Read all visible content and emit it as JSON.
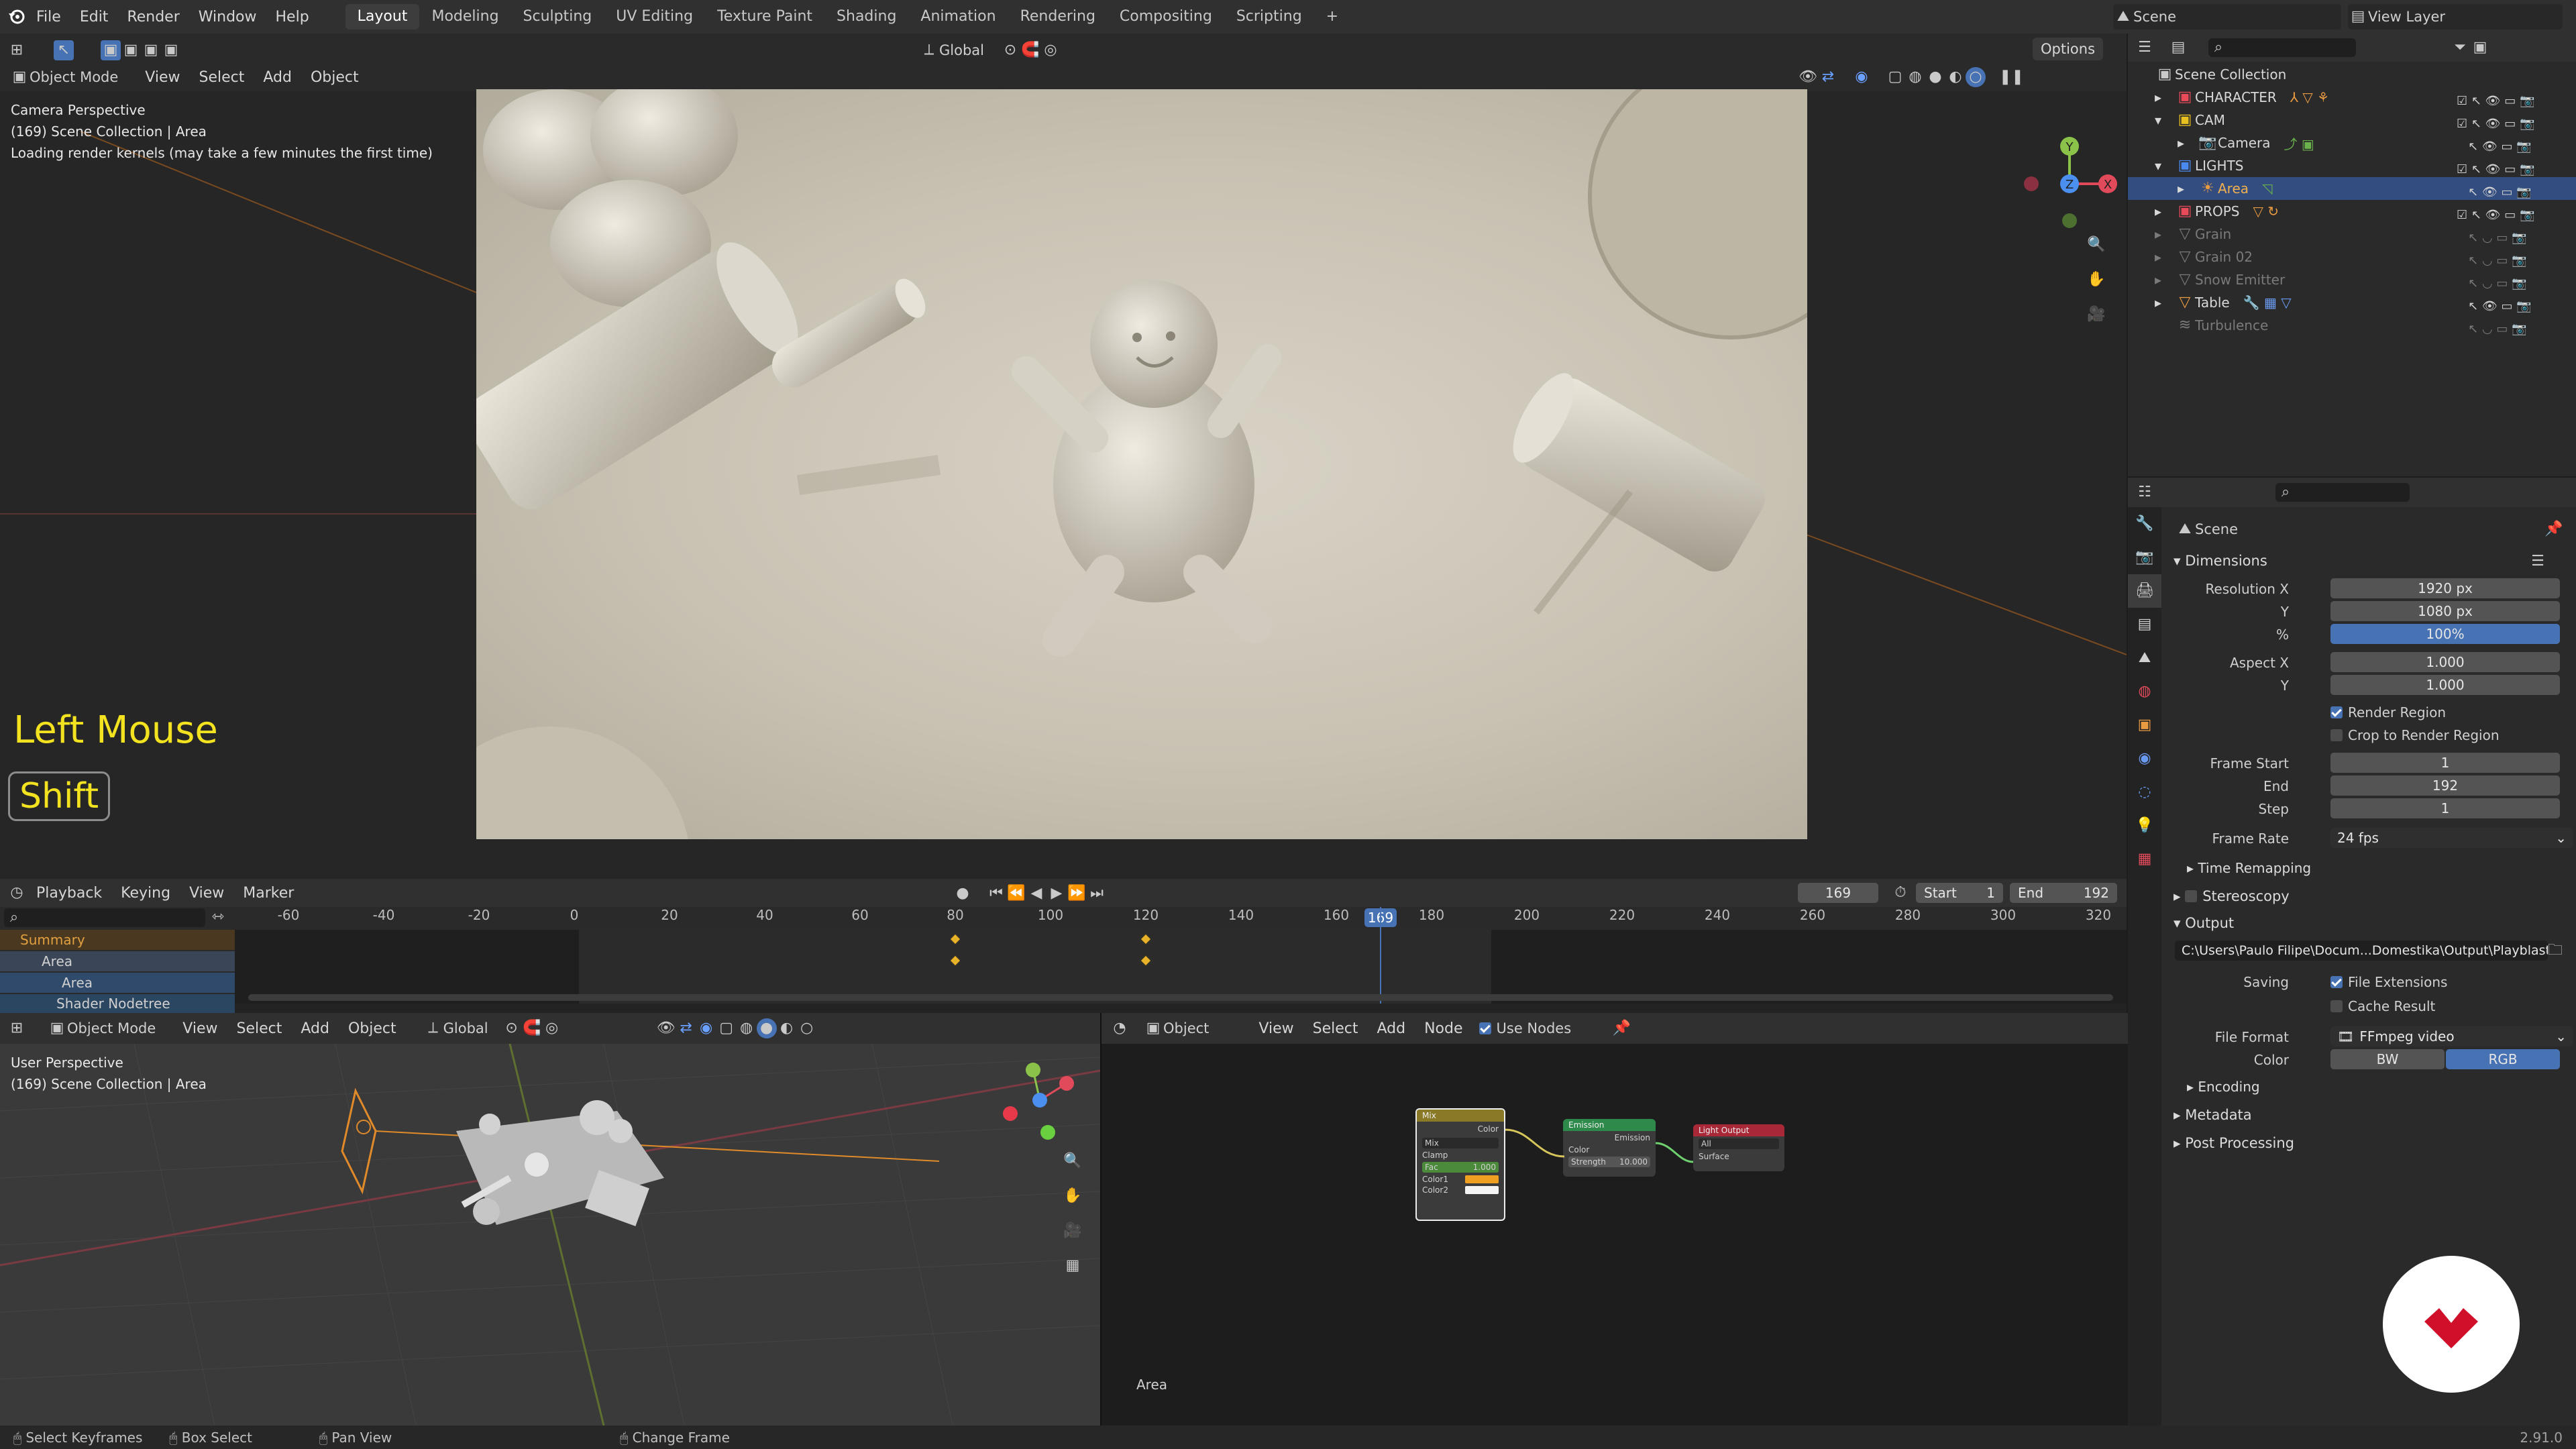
{
  "topbar": {
    "menus": [
      "File",
      "Edit",
      "Render",
      "Window",
      "Help"
    ],
    "workspaces": [
      "Layout",
      "Modeling",
      "Sculpting",
      "UV Editing",
      "Texture Paint",
      "Shading",
      "Animation",
      "Rendering",
      "Compositing",
      "Scripting"
    ],
    "add_tab": "+",
    "scene_name": "Scene",
    "view_layer": "View Layer"
  },
  "viewport": {
    "mode": "Object Mode",
    "menus": [
      "View",
      "Select",
      "Add",
      "Object"
    ],
    "transform_orientation": "Global",
    "options": "Options",
    "info_line1": "Camera Perspective",
    "info_line2": "(169) Scene Collection | Area",
    "info_line3": "Loading render kernels (may take a few minutes the first time)",
    "key_mouse": "Left Mouse",
    "key_modifier": "Shift",
    "gizmo": {
      "x": "X",
      "y": "Y",
      "z": "Z"
    }
  },
  "timeline": {
    "menus": [
      "Playback",
      "Keying",
      "View",
      "Marker"
    ],
    "current_frame": "169",
    "start_label": "Start",
    "start": "1",
    "end_label": "End",
    "end": "192",
    "ticks": [
      "-60",
      "-40",
      "-20",
      "0",
      "20",
      "40",
      "60",
      "80",
      "100",
      "120",
      "140",
      "160",
      "180",
      "200",
      "220",
      "240",
      "260",
      "280",
      "300",
      "320"
    ],
    "playhead": "169",
    "channels": [
      "Summary",
      "Area",
      "Area",
      "Shader Nodetree"
    ]
  },
  "viewport2": {
    "mode": "Object Mode",
    "menus": [
      "View",
      "Select",
      "Add",
      "Object"
    ],
    "transform_orientation": "Global",
    "info_line1": "User Perspective",
    "info_line2": "(169) Scene Collection | Area"
  },
  "node_editor": {
    "object": "Object",
    "menus": [
      "View",
      "Select",
      "Add",
      "Node"
    ],
    "use_nodes": "Use Nodes",
    "footer_name": "Area",
    "nodes": {
      "mix": {
        "title": "Mix",
        "out": "Color",
        "blend": "Mix",
        "clamp": "Clamp",
        "fac": "Fac",
        "fac_value": "1.000",
        "color1": "Color1",
        "color2": "Color2"
      },
      "emission": {
        "title": "Emission",
        "out": "Emission",
        "color": "Color",
        "strength": "Strength",
        "strength_value": "10.000"
      },
      "light_output": {
        "title": "Light Output",
        "target": "All",
        "surface": "Surface"
      }
    }
  },
  "outliner": {
    "root": "Scene Collection",
    "items": [
      {
        "label": "CHARACTER",
        "dim": false,
        "indent": 1
      },
      {
        "label": "CAM",
        "dim": false,
        "indent": 1
      },
      {
        "label": "Camera",
        "dim": false,
        "indent": 2
      },
      {
        "label": "LIGHTS",
        "dim": false,
        "indent": 1
      },
      {
        "label": "Area",
        "dim": false,
        "indent": 2,
        "selected": true
      },
      {
        "label": "PROPS",
        "dim": false,
        "indent": 1
      },
      {
        "label": "Grain",
        "dim": true,
        "indent": 1
      },
      {
        "label": "Grain 02",
        "dim": true,
        "indent": 1
      },
      {
        "label": "Snow Emitter",
        "dim": true,
        "indent": 1
      },
      {
        "label": "Table",
        "dim": false,
        "indent": 1
      },
      {
        "label": "Turbulence",
        "dim": true,
        "indent": 1
      }
    ]
  },
  "properties": {
    "context": "Scene",
    "dimensions": "Dimensions",
    "resolution_x_label": "Resolution X",
    "resolution_x": "1920 px",
    "y_label": "Y",
    "resolution_y": "1080 px",
    "pct_label": "%",
    "resolution_pct": "100%",
    "aspect_x_label": "Aspect X",
    "aspect_x": "1.000",
    "aspect_y": "1.000",
    "render_region": "Render Region",
    "crop_region": "Crop to Render Region",
    "frame_start_label": "Frame Start",
    "frame_start": "1",
    "end_label": "End",
    "frame_end": "192",
    "step_label": "Step",
    "frame_step": "1",
    "frame_rate_label": "Frame Rate",
    "frame_rate": "24 fps",
    "time_remapping": "Time Remapping",
    "stereoscopy": "Stereoscopy",
    "output": "Output",
    "output_path": "C:\\Users\\Paulo Filipe\\Docum...Domestika\\Output\\Playblast",
    "saving_label": "Saving",
    "file_extensions": "File Extensions",
    "cache_result": "Cache Result",
    "file_format_label": "File Format",
    "file_format": "FFmpeg video",
    "color_label": "Color",
    "color_bw": "BW",
    "color_rgb": "RGB",
    "encoding": "Encoding",
    "metadata": "Metadata",
    "post_processing": "Post Processing"
  },
  "statusbar": {
    "items": [
      "Select Keyframes",
      "Box Select",
      "Pan View",
      "Change Frame"
    ],
    "version": "2.91.0"
  },
  "colors": {
    "accent": "#4772b3",
    "keyframe": "#e8b22a",
    "key_text": "#f2e21f"
  }
}
